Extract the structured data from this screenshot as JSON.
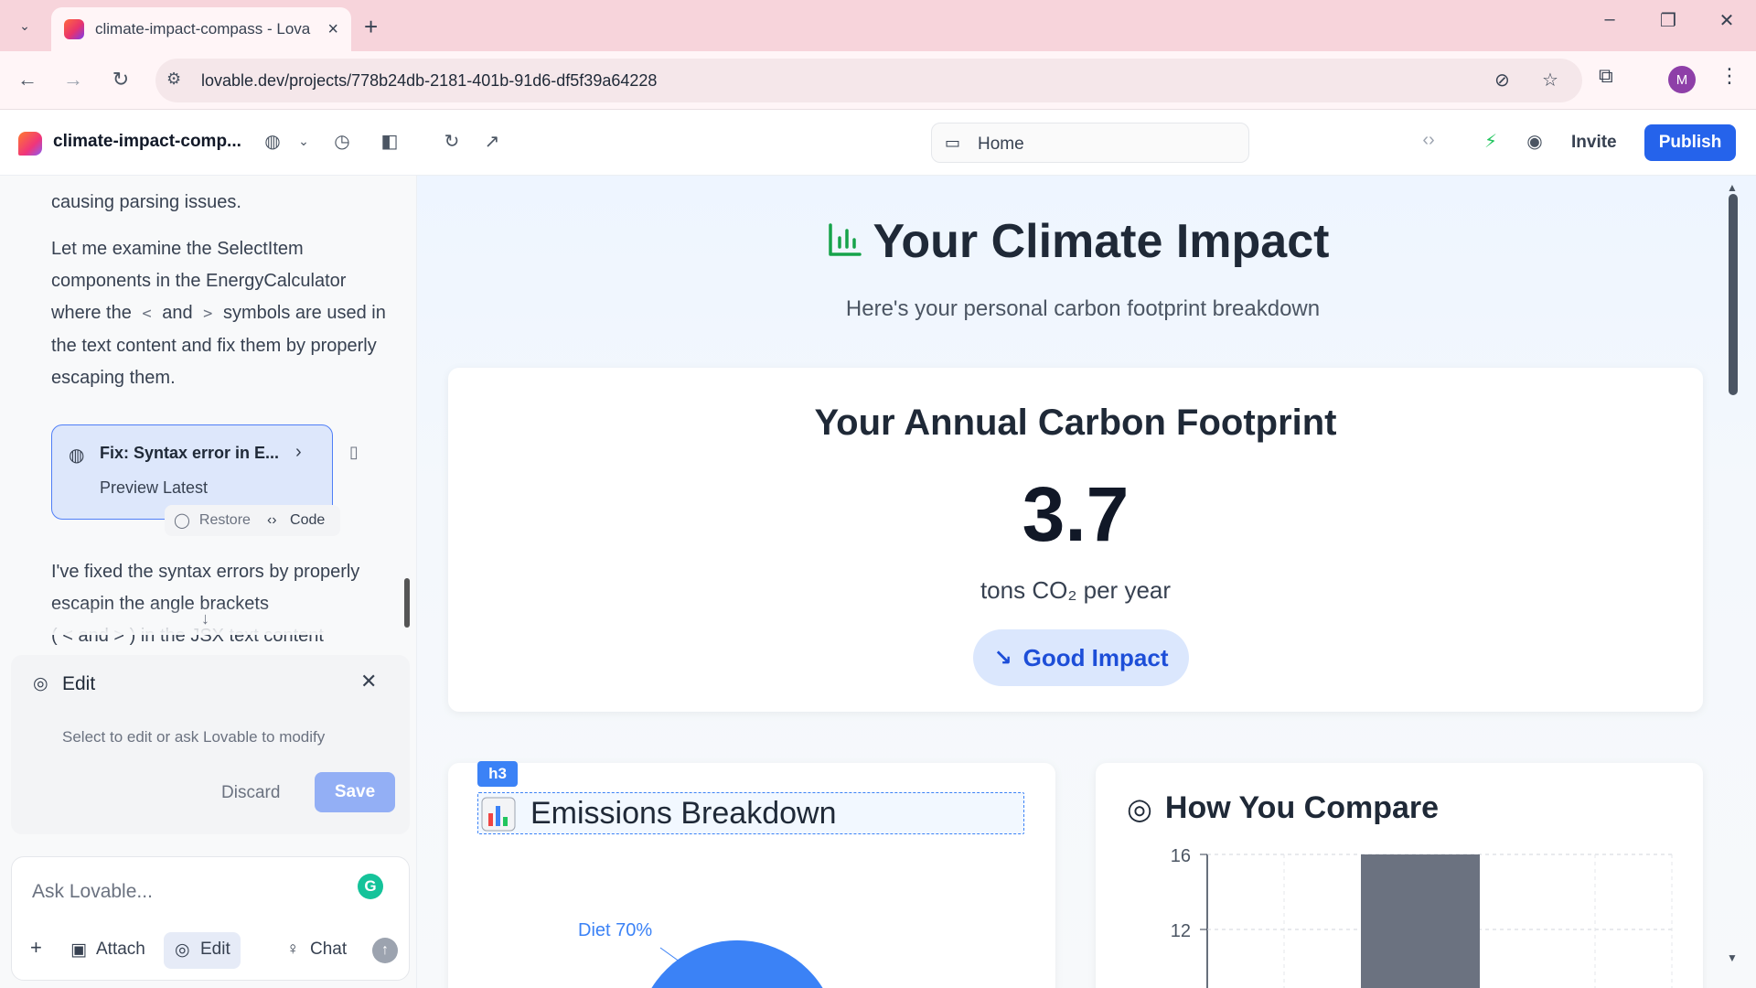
{
  "browser": {
    "tab_title": "climate-impact-compass - Lova",
    "url": "lovable.dev/projects/778b24db-2181-401b-91d6-df5f39a64228"
  },
  "toolbar": {
    "project_name": "climate-impact-comp...",
    "page_select": "Home",
    "invite_label": "Invite",
    "publish_label": "Publish"
  },
  "chat": {
    "para0": "causing parsing issues.",
    "para1_a": "Let me examine the SelectItem components in the EnergyCalculator where the",
    "lt": "<",
    "and": "and",
    "gt": ">",
    "para1_b": "symbols are used in the text content and fix them by properly escaping them.",
    "fix_card": {
      "title": "Fix: Syntax error in E...",
      "subtitle": "Preview Latest",
      "restore": "Restore",
      "code": "Code"
    },
    "para2_a": "I've fixed the syntax errors by properly escapin",
    "para2_b": "the angle brackets",
    "para2_c": "( < and > ) in the JSX text content"
  },
  "edit_panel": {
    "title": "Edit",
    "hint": "Select to edit or ask Lovable to modify",
    "discard": "Discard",
    "save": "Save"
  },
  "ask": {
    "placeholder": "Ask Lovable...",
    "attach": "Attach",
    "edit": "Edit",
    "chat": "Chat"
  },
  "preview": {
    "hero_title": "Your Climate Impact",
    "hero_subtitle": "Here's your personal carbon footprint breakdown",
    "footprint_title": "Your Annual Carbon Footprint",
    "footprint_value": "3.7",
    "footprint_unit": "tons CO₂ per year",
    "impact_badge": "Good Impact",
    "h3_tag": "h3",
    "emissions_title": "Emissions Breakdown",
    "pie_label": "Diet 70%",
    "compare_title": "How You Compare",
    "y_ticks": [
      "16",
      "12"
    ]
  },
  "colors": {
    "accent": "#2563eb",
    "impact_bg": "#dbe7fd",
    "pie_blue": "#3b82f6",
    "compare_bar": "#6b7280",
    "tabstrip": "#f7d4db"
  }
}
